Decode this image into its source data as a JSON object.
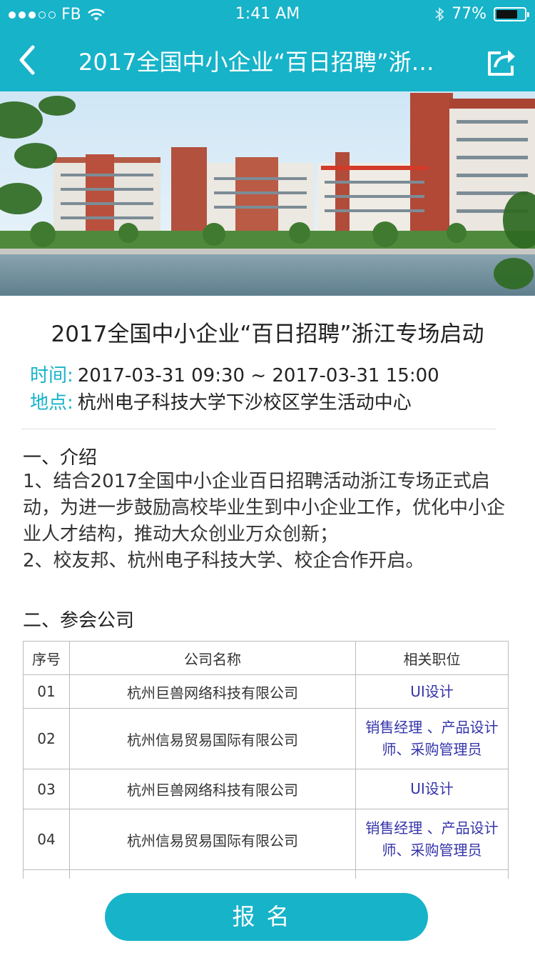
{
  "status_bar": {
    "carrier": "FB",
    "time": "1:41 AM",
    "battery_text": "77%",
    "battery_level": 0.77
  },
  "nav": {
    "title": "2017全国中小企业“百日招聘”浙江专场启动",
    "back_icon": "chevron-left-icon",
    "share_icon": "share-icon"
  },
  "article": {
    "title": "2017全国中小企业“百日招聘”浙江专场启动",
    "time_label": "时间:",
    "time_value": "2017-03-31 09:30 ~ 2017-03-31 15:00",
    "place_label": "地点:",
    "place_value": "杭州电子科技大学下沙校区学生活动中心"
  },
  "intro": {
    "heading": "一、介绍",
    "p1": "1、结合2017全国中小企业百日招聘活动浙江专场正式启动，为进一步鼓励高校毕业生到中小企业工作，优化中小企业人才结构，推动大众创业万众创新；",
    "p2": "2、校友邦、杭州电子科技大学、校企合作开启。"
  },
  "companies": {
    "heading": "二、参会公司",
    "columns": [
      "序号",
      "公司名称",
      "相关职位"
    ],
    "rows": [
      {
        "no": "01",
        "name": "杭州巨兽网络科技有限公司",
        "jobs": "UI设计"
      },
      {
        "no": "02",
        "name": "杭州信易贸易国际有限公司",
        "jobs": "销售经理 、产品设计师、采购管理员"
      },
      {
        "no": "03",
        "name": "杭州巨兽网络科技有限公司",
        "jobs": "UI设计"
      },
      {
        "no": "04",
        "name": "杭州信易贸易国际有限公司",
        "jobs": "销售经理 、产品设计师、采购管理员"
      }
    ]
  },
  "signup_label": "报名",
  "colors": {
    "accent": "#17b3c9",
    "link": "#3333aa"
  }
}
